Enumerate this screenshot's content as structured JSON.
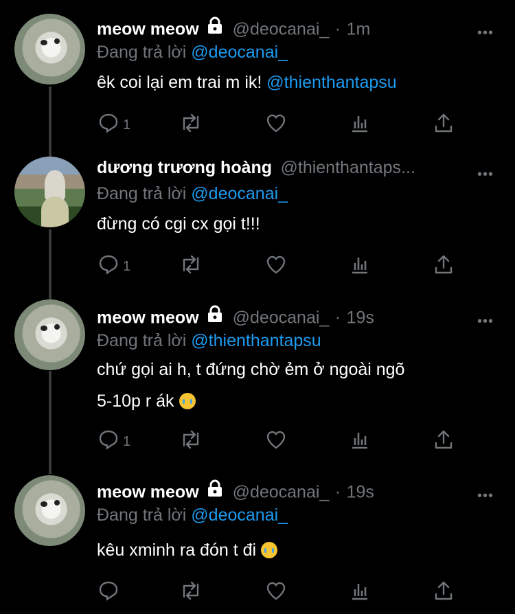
{
  "tweets": [
    {
      "name": "meow meow",
      "locked": true,
      "handle": "@deocanai_",
      "time": "1m",
      "reply_prefix": "Đang trả lời",
      "reply_to": "@deocanai_",
      "text_plain": "êk coi lại em trai m ik! ",
      "text_mention": "@thienthantapsu",
      "reply_count": "1",
      "avatar": "cat-avatar"
    },
    {
      "name": "dương trương hoàng",
      "locked": false,
      "handle": "@thienthantaps...",
      "time": "",
      "reply_prefix": "Đang trả lời",
      "reply_to": "@deocanai_",
      "text_plain": "đừng có cgi cx gọi t!!!",
      "text_mention": "",
      "reply_count": "1",
      "avatar": "person-avatar"
    },
    {
      "name": "meow meow",
      "locked": true,
      "handle": "@deocanai_",
      "time": "19s",
      "reply_prefix": "Đang trả lời",
      "reply_to": "@thienthantapsu",
      "text_line1": "chứ gọi ai h, t đứng chờ ẻm ở ngoài ngõ",
      "text_line2": "5-10p r ák",
      "emoji": "loudly-crying-face",
      "reply_count": "1",
      "avatar": "cat-avatar"
    },
    {
      "name": "meow meow",
      "locked": true,
      "handle": "@deocanai_",
      "time": "19s",
      "reply_prefix": "Đang trả lời",
      "reply_to": "@deocanai_",
      "text_plain": "kêu xminh ra đón t đi",
      "emoji": "crying-face",
      "reply_count": "",
      "avatar": "cat-avatar"
    }
  ],
  "ui": {
    "more_glyph": "•••",
    "dot": "·",
    "background": "#000000",
    "accent": "#1d9bf0",
    "muted": "#71767b"
  }
}
